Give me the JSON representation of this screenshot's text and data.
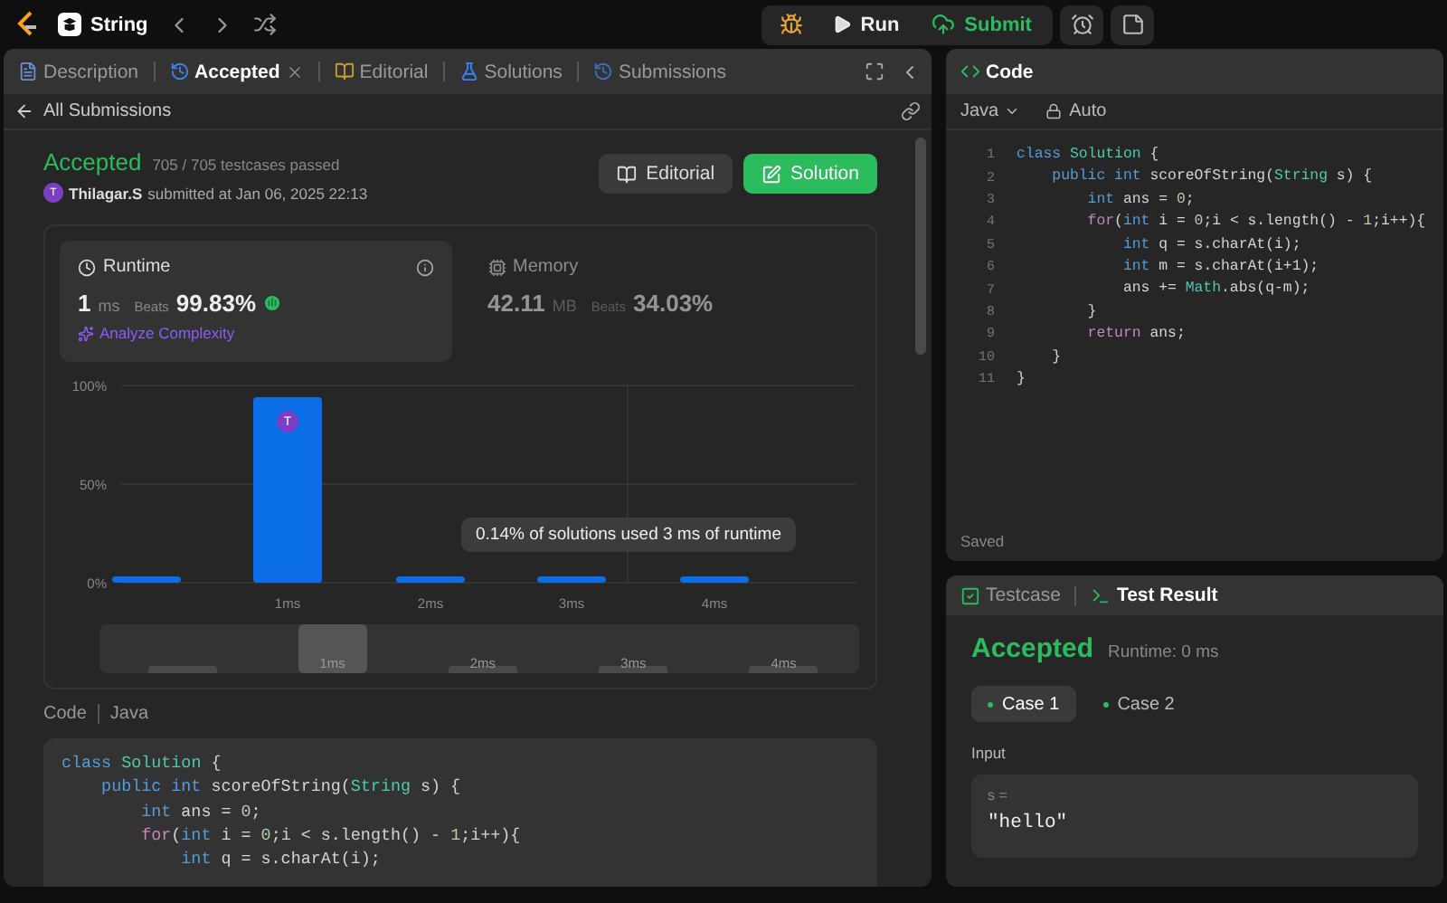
{
  "topbar": {
    "problem": "String",
    "run": "Run",
    "submit": "Submit"
  },
  "left_tabs": [
    {
      "kind": "description",
      "label": "Description",
      "selected": false,
      "closable": false
    },
    {
      "kind": "accepted",
      "label": "Accepted",
      "selected": true,
      "closable": true
    },
    {
      "kind": "editorial",
      "label": "Editorial",
      "selected": false,
      "closable": false
    },
    {
      "kind": "solutions",
      "label": "Solutions",
      "selected": false,
      "closable": false
    },
    {
      "kind": "submissions",
      "label": "Submissions",
      "selected": false,
      "closable": false
    }
  ],
  "submission": {
    "back": "All Submissions",
    "status": "Accepted",
    "testcases": "705 / 705 testcases passed",
    "avatar": "T",
    "user": "Thilagar.S",
    "submitted": "submitted at Jan 06, 2025 22:13",
    "buttons": [
      {
        "kind": "editorial",
        "label": "Editorial"
      },
      {
        "kind": "solution",
        "label": "Solution"
      }
    ]
  },
  "stats": [
    {
      "kind": "runtime",
      "title": "Runtime",
      "value": "1",
      "unit": "ms",
      "beats_label": "Beats",
      "beats": "99.83%",
      "selected": true,
      "link": "Analyze Complexity"
    },
    {
      "kind": "memory",
      "title": "Memory",
      "value": "42.11",
      "unit": "MB",
      "beats_label": "Beats",
      "beats": "34.03%",
      "selected": false
    }
  ],
  "distribution": {
    "chart_data": {
      "type": "bar",
      "categories": [
        null,
        "1ms",
        "2ms",
        "3ms",
        "4ms"
      ],
      "values": [
        3,
        94,
        3,
        3,
        3
      ],
      "ylim": [
        0,
        100
      ],
      "yticks": [
        {
          "value": 0,
          "label": "0%"
        },
        {
          "value": 50,
          "label": "50%"
        },
        {
          "value": 100,
          "label": "100%"
        }
      ]
    },
    "marker": "T",
    "tooltip": "0.14% of solutions used 3 ms of runtime",
    "overview": [
      {
        "selected": false
      },
      {
        "label": "1ms",
        "selected": true
      },
      {
        "label": "2ms",
        "selected": false
      },
      {
        "label": "3ms",
        "selected": false
      },
      {
        "label": "4ms",
        "selected": false
      }
    ]
  },
  "code_section": {
    "title": "Code",
    "language": "Java",
    "lines": [
      [
        {
          "kind": "kw",
          "text": "class "
        },
        {
          "kind": "cls",
          "text": "Solution"
        },
        {
          "kind": "plain",
          "text": " {"
        }
      ],
      [
        {
          "kind": "kw",
          "text": "    public int "
        },
        {
          "kind": "plain",
          "text": "scoreOfString("
        },
        {
          "kind": "cls",
          "text": "String"
        },
        {
          "kind": "plain",
          "text": " s) {"
        }
      ],
      [
        {
          "kind": "kw",
          "text": "        int "
        },
        {
          "kind": "plain",
          "text": "ans = "
        },
        {
          "kind": "num",
          "text": "0"
        },
        {
          "kind": "plain",
          "text": ";"
        }
      ],
      [
        {
          "kind": "ctrl",
          "text": "        for"
        },
        {
          "kind": "plain",
          "text": "("
        },
        {
          "kind": "kw",
          "text": "int "
        },
        {
          "kind": "plain",
          "text": "i = "
        },
        {
          "kind": "num",
          "text": "0"
        },
        {
          "kind": "plain",
          "text": ";i < s.length() - "
        },
        {
          "kind": "num",
          "text": "1"
        },
        {
          "kind": "plain",
          "text": ";i++){"
        }
      ],
      [
        {
          "kind": "kw",
          "text": "            int "
        },
        {
          "kind": "plain",
          "text": "q = s.charAt(i);"
        }
      ]
    ]
  },
  "editor": {
    "title": "Code",
    "language": "Java",
    "mode": "Auto",
    "status": "Saved",
    "lines": [
      {
        "number": "1",
        "tokens": [
          {
            "kind": "kw",
            "text": "class "
          },
          {
            "kind": "cls",
            "text": "Solution"
          },
          {
            "kind": "plain",
            "text": " {"
          }
        ]
      },
      {
        "number": "2",
        "tokens": [
          {
            "kind": "kw",
            "text": "    public int "
          },
          {
            "kind": "plain",
            "text": "scoreOfString("
          },
          {
            "kind": "cls",
            "text": "String"
          },
          {
            "kind": "plain",
            "text": " s) {"
          }
        ]
      },
      {
        "number": "3",
        "tokens": [
          {
            "kind": "kw",
            "text": "        int "
          },
          {
            "kind": "plain",
            "text": "ans = "
          },
          {
            "kind": "num",
            "text": "0"
          },
          {
            "kind": "plain",
            "text": ";"
          }
        ]
      },
      {
        "number": "4",
        "tokens": [
          {
            "kind": "ctrl",
            "text": "        for"
          },
          {
            "kind": "plain",
            "text": "("
          },
          {
            "kind": "kw",
            "text": "int "
          },
          {
            "kind": "plain",
            "text": "i = "
          },
          {
            "kind": "num",
            "text": "0"
          },
          {
            "kind": "plain",
            "text": ";i < s.length() - "
          },
          {
            "kind": "num",
            "text": "1"
          },
          {
            "kind": "plain",
            "text": ";i++){"
          }
        ]
      },
      {
        "number": "5",
        "tokens": [
          {
            "kind": "kw",
            "text": "            int "
          },
          {
            "kind": "plain",
            "text": "q = s.charAt(i);"
          }
        ]
      },
      {
        "number": "6",
        "tokens": [
          {
            "kind": "kw",
            "text": "            int "
          },
          {
            "kind": "plain",
            "text": "m = s.charAt(i+1);"
          }
        ]
      },
      {
        "number": "7",
        "tokens": [
          {
            "kind": "plain",
            "text": "            ans += "
          },
          {
            "kind": "cls",
            "text": "Math"
          },
          {
            "kind": "plain",
            "text": ".abs(q-m);"
          }
        ]
      },
      {
        "number": "8",
        "tokens": [
          {
            "kind": "plain",
            "text": "        }"
          }
        ]
      },
      {
        "number": "9",
        "tokens": [
          {
            "kind": "ctrl",
            "text": "        return "
          },
          {
            "kind": "plain",
            "text": "ans;"
          }
        ]
      },
      {
        "number": "10",
        "tokens": [
          {
            "kind": "plain",
            "text": "    }"
          }
        ]
      },
      {
        "number": "11",
        "tokens": [
          {
            "kind": "plain",
            "text": "}"
          }
        ]
      }
    ]
  },
  "test": {
    "tabs": [
      {
        "kind": "testcase",
        "label": "Testcase",
        "selected": false
      },
      {
        "kind": "result",
        "label": "Test Result",
        "selected": true
      }
    ],
    "verdict": "Accepted",
    "runtime": "Runtime: 0 ms",
    "cases": [
      {
        "label": "Case 1",
        "selected": true
      },
      {
        "label": "Case 2",
        "selected": false
      }
    ],
    "input_label": "Input",
    "inputs": [
      {
        "name": "s =",
        "value": "\"hello\""
      }
    ]
  }
}
